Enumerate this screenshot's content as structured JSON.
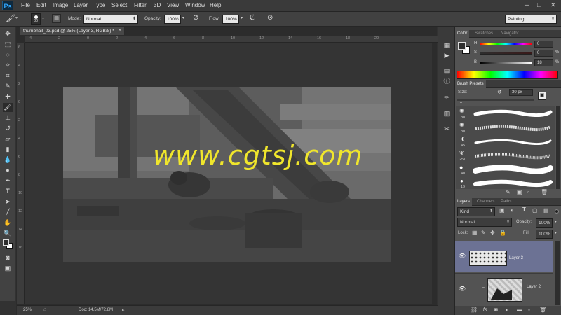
{
  "app": {
    "logo": "Ps"
  },
  "menu": {
    "items": [
      "File",
      "Edit",
      "Image",
      "Layer",
      "Type",
      "Select",
      "Filter",
      "3D",
      "View",
      "Window",
      "Help"
    ]
  },
  "window_controls": {
    "minimize": "─",
    "maximize": "□",
    "close": "✕"
  },
  "options": {
    "brush_size": "30",
    "mode_label": "Mode:",
    "mode_value": "Normal",
    "opacity_label": "Opacity:",
    "opacity_value": "100%",
    "flow_label": "Flow:",
    "flow_value": "100%",
    "workspace": "Painting"
  },
  "document": {
    "tab_title": "thumbnail_03.psd @ 25% (Layer 3, RGB/8) *",
    "ruler_top": [
      "4",
      "2",
      "0",
      "2",
      "4",
      "6",
      "8",
      "10",
      "12",
      "14",
      "16",
      "18",
      "20"
    ],
    "ruler_left": [
      "6",
      "4",
      "2",
      "0",
      "2",
      "4",
      "6",
      "8",
      "10",
      "12",
      "14",
      "16"
    ],
    "watermark": "www.cgtsj.com",
    "zoom": "25%",
    "doc_info": "Doc: 14.5M/72.8M"
  },
  "color_panel": {
    "tabs": [
      "Color",
      "Swatches",
      "Navigator"
    ],
    "h_label": "H",
    "h_value": "0",
    "s_label": "S",
    "s_value": "0",
    "s_unit": "%",
    "b_label": "B",
    "b_value": "18",
    "b_unit": "%",
    "foreground": "#2e2e2e",
    "background": "#ffffff"
  },
  "brush_presets": {
    "title": "Brush Presets",
    "size_label": "Size:",
    "size_value": "30 px",
    "sizes": [
      "80",
      "80",
      "45",
      "251",
      "40",
      "19"
    ]
  },
  "layers_panel": {
    "tabs": [
      "Layers",
      "Channels",
      "Paths"
    ],
    "kind": "Kind",
    "blend_mode": "Normal",
    "opacity_label": "Opacity:",
    "opacity_value": "100%",
    "lock_label": "Lock:",
    "fill_label": "Fill:",
    "fill_value": "100%",
    "layers": [
      {
        "name": "Layer 3",
        "selected": true
      },
      {
        "name": "Layer 2",
        "selected": false
      }
    ],
    "footer_icons": [
      "link-icon",
      "fx-icon",
      "mask-icon",
      "adjustment-icon",
      "group-icon",
      "new-layer-icon",
      "trash-icon"
    ]
  },
  "colors": {
    "accent_selected_layer": "#6c7294",
    "watermark": "#f0e62c"
  }
}
